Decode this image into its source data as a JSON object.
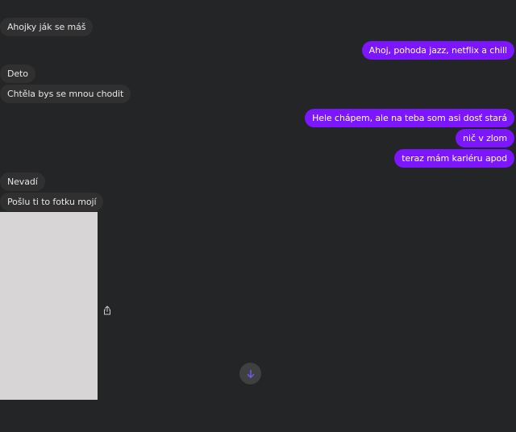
{
  "messages": {
    "m1": "Ahojky ják se máš",
    "m2": "Ahoj, pohoda jazz, netflix a chill",
    "m3": "Deto",
    "m4": "Chtěla bys se mnou chodit",
    "m5": "Hele chápem, ale na teba som asi dosť stará",
    "m6": "nič v zlom",
    "m7": "teraz mám kariéru apod",
    "m8": "Nevadí",
    "m9": "Pošlu ti to fotku mojí"
  },
  "icons": {
    "share": "share-icon",
    "scroll_down": "arrow-down-icon"
  },
  "colors": {
    "background": "#242526",
    "incoming_bubble": "#303030",
    "outgoing_bubble": "#7b16ff",
    "scroll_arrow": "#6c5ce7"
  }
}
